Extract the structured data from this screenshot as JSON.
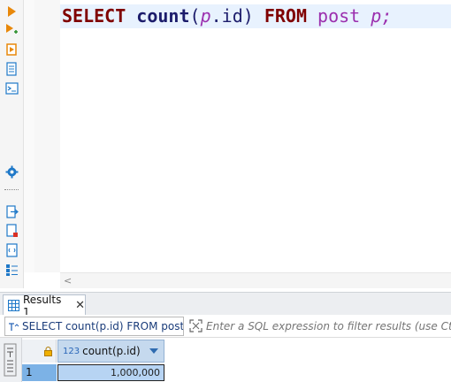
{
  "editor": {
    "query": {
      "kw_select": "SELECT",
      "fn_count": "count",
      "paren_open": "(",
      "alias_p": "p",
      "field": ".id",
      "paren_close": ")",
      "kw_from": "FROM",
      "table": "post",
      "alias_p2": "p",
      "semicolon": ";"
    },
    "hscroll_arrow": "<"
  },
  "toolbar": {
    "icons": [
      "execute-statement-icon",
      "execute-in-new-tab-icon",
      "execute-script-icon",
      "explain-plan-icon",
      "output-console-icon",
      "settings-icon",
      "export-results-icon",
      "load-script-icon",
      "format-sql-icon",
      "outline-icon"
    ],
    "colors": {
      "play": "#e8880a",
      "blue": "#1e78c8",
      "red": "#d93025"
    }
  },
  "results": {
    "tab_label": "Results 1",
    "close_glyph": "✕",
    "filter": {
      "sql_text": "SELECT count(p.id) FROM post p",
      "placeholder": "Enter a SQL expression to filter results (use Ctrl+Space)"
    },
    "grid": {
      "columns": [
        {
          "type_label": "123",
          "name": "count(p.id)"
        }
      ],
      "rows": [
        {
          "row_number": "1",
          "cells": [
            "1,000,000"
          ]
        }
      ]
    }
  }
}
